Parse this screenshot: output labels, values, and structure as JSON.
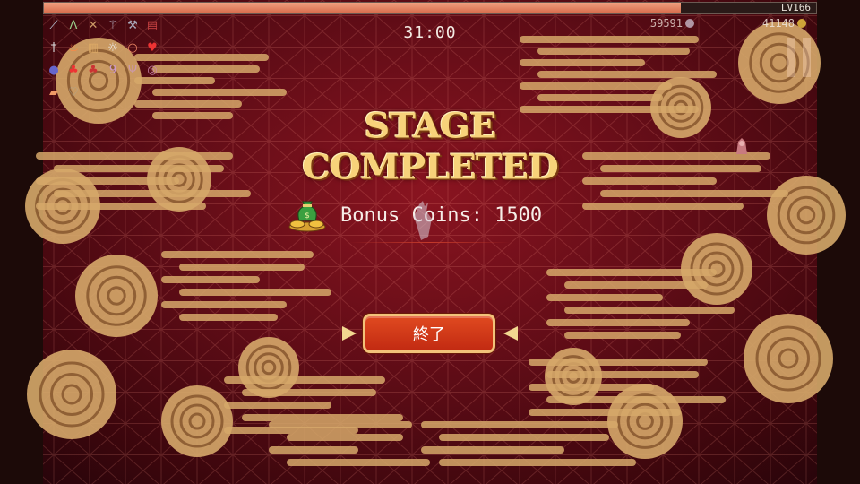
{
  "hud": {
    "level": "LV166",
    "xp_progress": 0.825,
    "timer": "31:00",
    "kills": "59591",
    "gold": "41148"
  },
  "inventory": {
    "weapons": [
      "whip-icon",
      "bird-icon",
      "crossbow-icon",
      "wand-icon",
      "axe-icon",
      "book-icon"
    ],
    "row2": [
      "knife-icon",
      "fire-icon",
      "tome-icon",
      "garlic-icon",
      "ring-icon",
      "heart-icon"
    ],
    "row3": [
      "bomb-icon",
      "spinach-icon",
      "clover-icon",
      "nine-icon",
      "candle-icon",
      "donut-icon"
    ],
    "row4": [
      "bandage-icon",
      "heart-outline-icon"
    ]
  },
  "result": {
    "title_line1": "STAGE",
    "title_line2": "COMPLETED",
    "bonus_label": "Bonus Coins: 1500",
    "end_button": "終了"
  },
  "colors": {
    "background": "#5e0c16",
    "title": "#f7d27a",
    "button": "#d03a18",
    "button_border": "#f2c27a",
    "cloud": "#d6a86a"
  }
}
